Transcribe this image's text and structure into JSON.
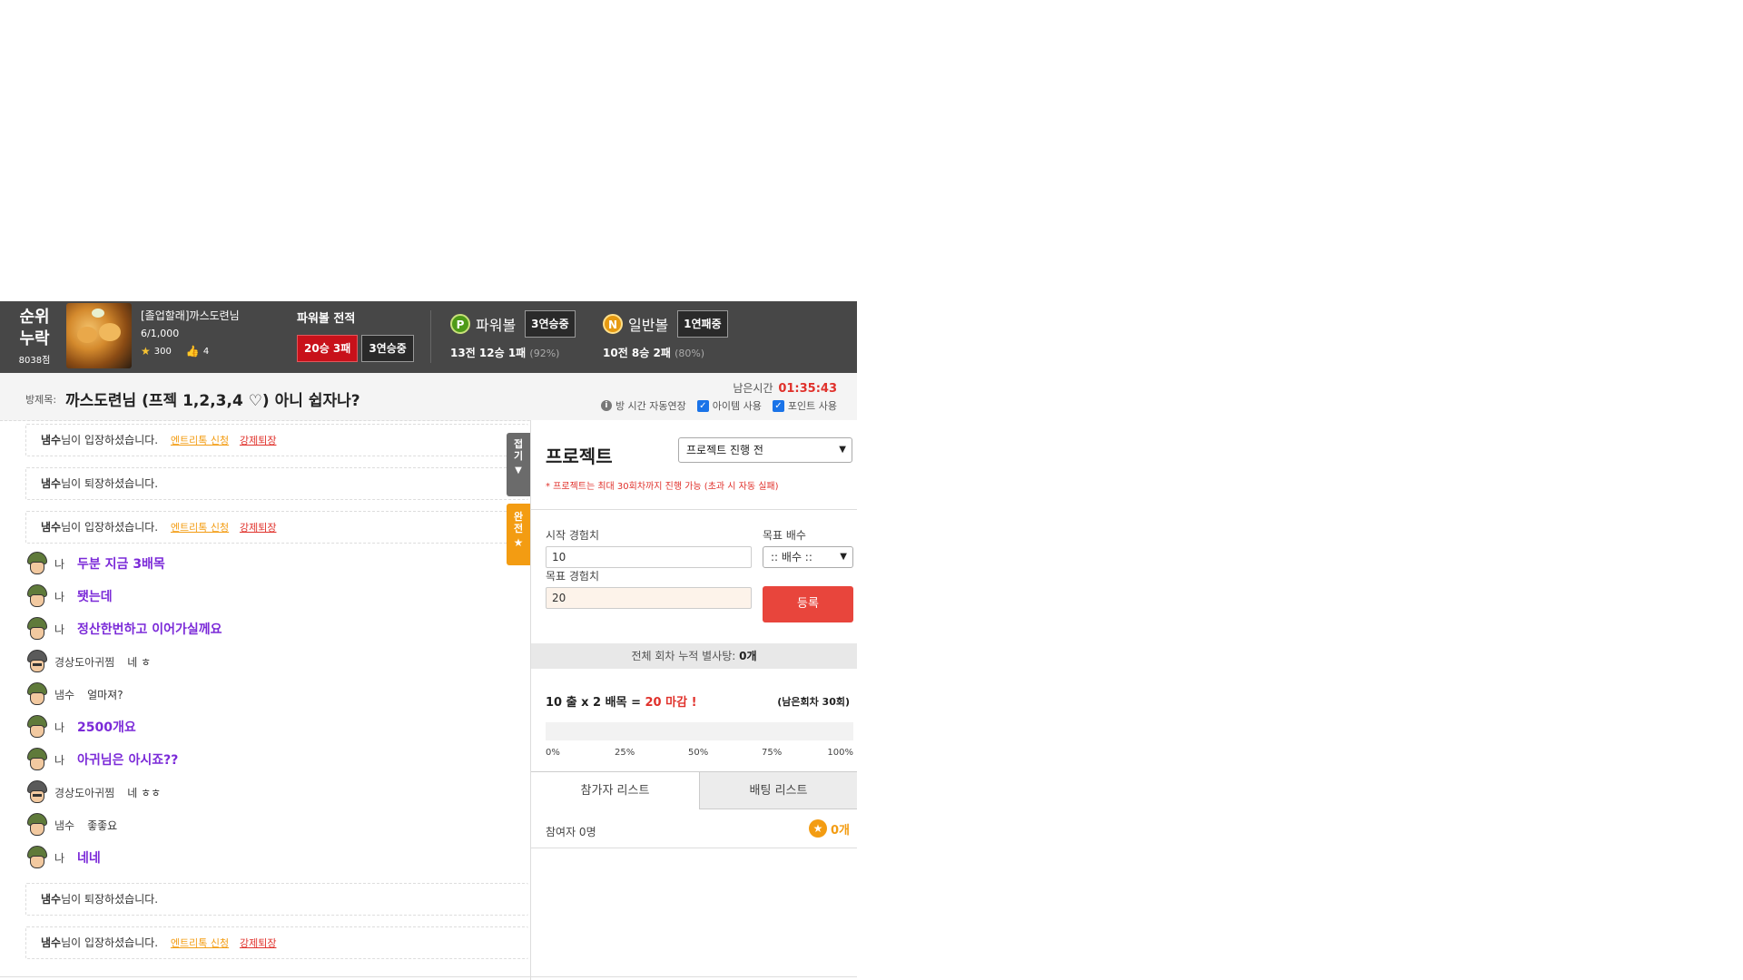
{
  "header": {
    "rank": {
      "line1": "순위",
      "line2": "누락",
      "points": "8038점"
    },
    "user": {
      "name": "[졸업할래]까스도련님",
      "exp": "6/1,000",
      "stars": "300",
      "likes": "4"
    },
    "powerball_record": {
      "title": "파워볼 전적",
      "record": "20승 3패",
      "streak": "3연승중"
    },
    "powerball": {
      "icon": "P",
      "name": "파워볼",
      "streak": "3연승중",
      "record": "13전 12승 1패",
      "pct": "(92%)"
    },
    "normalball": {
      "icon": "N",
      "name": "일반볼",
      "streak": "1연패중",
      "record": "10전 8승 2패",
      "pct": "(80%)"
    }
  },
  "room": {
    "label": "방제목:",
    "title": "까스도련님 (프젝 1,2,3,4 ♡) 아니 쉽자나?",
    "remain_label": "남은시간",
    "remain_time": "01:35:43",
    "auto_extend": "방 시간 자동연장",
    "use_item": "아이템 사용",
    "use_point": "포인트 사용"
  },
  "chat": {
    "sys": [
      {
        "name": "냄수",
        "text": "님이 입장하셨습니다.",
        "links": true
      },
      {
        "name": "냄수",
        "text": "님이 퇴장하셨습니다.",
        "links": false
      },
      {
        "name": "냄수",
        "text": "님이 입장하셨습니다.",
        "links": true
      },
      {
        "name": "냄수",
        "text": "님이 퇴장하셨습니다.",
        "links": false
      },
      {
        "name": "냄수",
        "text": "님이 입장하셨습니다.",
        "links": true
      }
    ],
    "entry_link": "엔트리톡 신청",
    "kick_link": "강제퇴장",
    "lines": [
      {
        "who": "나",
        "msg": "두분 지금 3배목"
      },
      {
        "who": "나",
        "msg": "됏는데"
      },
      {
        "who": "나",
        "msg": "정산한번하고 이어가실께요"
      },
      {
        "who": "경상도아귀찜",
        "msg": "네 ㅎ"
      },
      {
        "who": "냄수",
        "msg": "얼마져?"
      },
      {
        "who": "나",
        "msg": "2500개요"
      },
      {
        "who": "나",
        "msg": "아귀님은 아시죠??"
      },
      {
        "who": "경상도아귀찜",
        "msg": "네 ㅎㅎ"
      },
      {
        "who": "냄수",
        "msg": "좋좋요"
      },
      {
        "who": "나",
        "msg": "네네"
      }
    ],
    "fold_tab": {
      "l1": "접",
      "l2": "기",
      "arrow": "▼"
    },
    "full_tab": {
      "l1": "완",
      "l2": "전",
      "star": "★"
    }
  },
  "panel": {
    "title": "프로젝트",
    "status_select": "프로젝트 진행 전",
    "note": "* 프로젝트는 최대 30회차까지 진행 가능 (초과 시 자동 실패)",
    "start_label": "시작 경험치",
    "start_value": "10",
    "target_label": "목표 경험치",
    "target_value": "20",
    "mult_label": "목표 배수",
    "mult_select": ":: 배수 ::",
    "register": "등록",
    "total": {
      "prefix": "전체 회차 누적 별사탕:",
      "value": "0개"
    },
    "calc": {
      "start": "10",
      "unit1": "출",
      "x": "x",
      "mult": "2",
      "unit2": "배목",
      "eq": "=",
      "result": "20 마감 !"
    },
    "remain_rounds": "(남은회차 30회)",
    "progress": 0,
    "ticks": [
      "0%",
      "25%",
      "50%",
      "75%",
      "100%"
    ],
    "tab_participants": "참가자 리스트",
    "tab_betting": "배팅 리스트",
    "participants": "참여자 0명",
    "reward": "0개"
  },
  "colors": {
    "accent_red": "#e8453c",
    "orange": "#f39c12",
    "purple": "#7b2ad8",
    "header_bg": "#474747"
  }
}
